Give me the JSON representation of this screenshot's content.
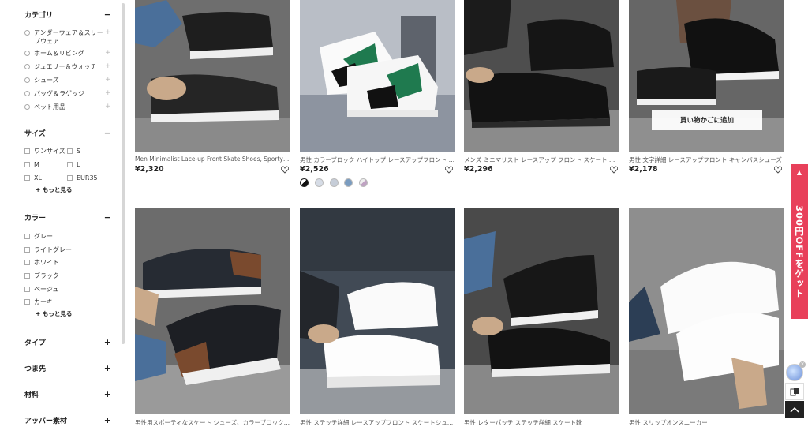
{
  "sidebar": {
    "category": {
      "title": "カテゴリ",
      "toggle": "−",
      "items": [
        "アンダーウェア＆スリープウェア",
        "ホーム＆リビング",
        "ジュエリー＆ウォッチ",
        "シューズ",
        "バッグ＆ラゲッジ",
        "ペット用品"
      ]
    },
    "size": {
      "title": "サイズ",
      "toggle": "−",
      "items": [
        "ワンサイズ",
        "S",
        "M",
        "L",
        "XL",
        "EUR35"
      ],
      "more": "+ もっと見る"
    },
    "color": {
      "title": "カラー",
      "toggle": "−",
      "items": [
        "グレー",
        "ライトグレー",
        "ホワイト",
        "ブラック",
        "ベージュ",
        "カーキ"
      ],
      "more": "+ もっと見る"
    },
    "collapsed": [
      {
        "title": "タイプ",
        "toggle": "+"
      },
      {
        "title": "つま先",
        "toggle": "+"
      },
      {
        "title": "材料",
        "toggle": "+"
      },
      {
        "title": "アッパー素材",
        "toggle": "+"
      }
    ]
  },
  "products": [
    {
      "name": "Men Minimalist Lace-up Front Skate Shoes, Sporty Outdoor",
      "price": "¥2,320"
    },
    {
      "name": "男性 カラーブロック ハイトップ レースアップフロント スケートシューズ",
      "price": "¥2,526"
    },
    {
      "name": "メンズ ミニマリスト レースアップ フロント スケート シューズ",
      "price": "¥2,296"
    },
    {
      "name": "男性 文字詳細 レースアップフロント キャンバスシューズ",
      "price": "¥2,178",
      "cart_button": "買い物かごに追加"
    },
    {
      "name": "男性用スポーティなスケート シューズ、カラーブロック レースアップ",
      "price": ""
    },
    {
      "name": "男性 ステッチ詳細 レースアップフロント スケートシューズ",
      "price": ""
    },
    {
      "name": "男性 レターパッチ ステッチ詳細 スケート靴",
      "price": ""
    },
    {
      "name": "男性 スリップオンスニーカー",
      "price": ""
    }
  ],
  "promo": {
    "text": "300円OFFをゲット",
    "arrow": "▲"
  },
  "colors": {
    "accent": "#e8405a"
  }
}
